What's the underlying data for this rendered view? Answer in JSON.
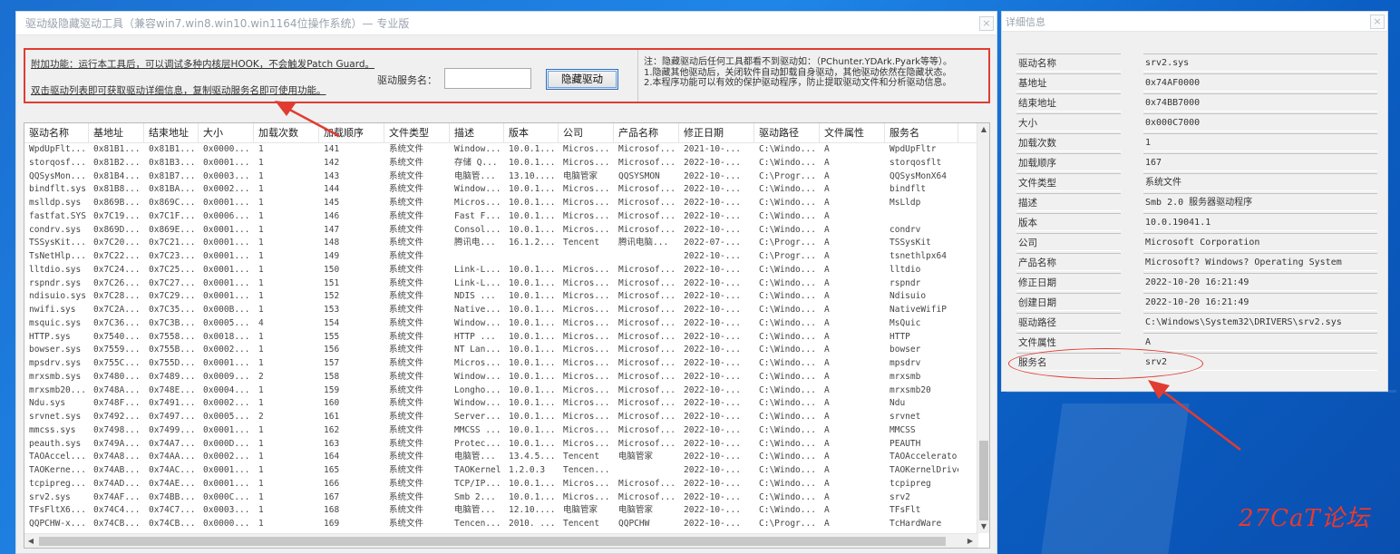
{
  "main_window": {
    "title": "驱动级隐藏驱动工具（兼容win7.win8.win10.win1164位操作系统）— 专业版",
    "close_label": "×"
  },
  "top_panel": {
    "extra_feature_text": "附加功能：运行本工具后，可以调试多种内核层HOOK，不会触发Patch Guard。",
    "double_click_text": "双击驱动列表即可获取驱动详细信息，复制驱动服务名即可使用功能。",
    "service_name_label": "驱动服务名：",
    "service_name_value": "",
    "hide_button_label": "隐藏驱动",
    "notes": [
      "注：隐藏驱动后任何工具都看不到驱动如：（PChunter.YDArk.Pyark等等）。",
      "1.隐藏其他驱动后，关闭软件自动卸载自身驱动，其他驱动依然在隐藏状态。",
      "2.本程序功能可以有效的保护驱动程序，防止提取驱动文件和分析驱动信息。"
    ]
  },
  "driver_table": {
    "columns": [
      "驱动名称",
      "基地址",
      "结束地址",
      "大小",
      "加载次数",
      "加载顺序",
      "文件类型",
      "描述",
      "版本",
      "公司",
      "产品名称",
      "修正日期",
      "驱动路径",
      "文件属性",
      "服务名"
    ],
    "rows": [
      [
        "WpdUpFlt...",
        "0x81B1...",
        "0x81B1...",
        "0x0000...",
        "1",
        "141",
        "系统文件",
        "Window...",
        "10.0.1...",
        "Micros...",
        "Microsof...",
        "2021-10-...",
        "C:\\Windo...",
        "A",
        "WpdUpFltr"
      ],
      [
        "storqosf...",
        "0x81B2...",
        "0x81B3...",
        "0x0001...",
        "1",
        "142",
        "系统文件",
        "存储 Q...",
        "10.0.1...",
        "Micros...",
        "Microsof...",
        "2022-10-...",
        "C:\\Windo...",
        "A",
        "storqosflt"
      ],
      [
        "QQSysMon...",
        "0x81B4...",
        "0x81B7...",
        "0x0003...",
        "1",
        "143",
        "系统文件",
        "电脑管...",
        "13.10....",
        "电脑管家",
        "QQSYSMON",
        "2022-10-...",
        "C:\\Progr...",
        "A",
        "QQSysMonX64"
      ],
      [
        "bindflt.sys",
        "0x81B8...",
        "0x81BA...",
        "0x0002...",
        "1",
        "144",
        "系统文件",
        "Window...",
        "10.0.1...",
        "Micros...",
        "Microsof...",
        "2022-10-...",
        "C:\\Windo...",
        "A",
        "bindflt"
      ],
      [
        "mslldp.sys",
        "0x869B...",
        "0x869C...",
        "0x0001...",
        "1",
        "145",
        "系统文件",
        "Micros...",
        "10.0.1...",
        "Micros...",
        "Microsof...",
        "2022-10-...",
        "C:\\Windo...",
        "A",
        "MsLldp"
      ],
      [
        "fastfat.SYS",
        "0x7C19...",
        "0x7C1F...",
        "0x0006...",
        "1",
        "146",
        "系统文件",
        "Fast F...",
        "10.0.1...",
        "Micros...",
        "Microsof...",
        "2022-10-...",
        "C:\\Windo...",
        "A",
        ""
      ],
      [
        "condrv.sys",
        "0x869D...",
        "0x869E...",
        "0x0001...",
        "1",
        "147",
        "系统文件",
        "Consol...",
        "10.0.1...",
        "Micros...",
        "Microsof...",
        "2022-10-...",
        "C:\\Windo...",
        "A",
        "condrv"
      ],
      [
        "TSSysKit...",
        "0x7C20...",
        "0x7C21...",
        "0x0001...",
        "1",
        "148",
        "系统文件",
        "腾讯电...",
        "16.1.2...",
        "Tencent",
        "腾讯电脑...",
        "2022-07-...",
        "C:\\Progr...",
        "A",
        "TSSysKit"
      ],
      [
        "TsNetHlp...",
        "0x7C22...",
        "0x7C23...",
        "0x0001...",
        "1",
        "149",
        "系统文件",
        "",
        "",
        "",
        "",
        "2022-10-...",
        "C:\\Progr...",
        "A",
        "tsnethlpx64"
      ],
      [
        "lltdio.sys",
        "0x7C24...",
        "0x7C25...",
        "0x0001...",
        "1",
        "150",
        "系统文件",
        "Link-L...",
        "10.0.1...",
        "Micros...",
        "Microsof...",
        "2022-10-...",
        "C:\\Windo...",
        "A",
        "lltdio"
      ],
      [
        "rspndr.sys",
        "0x7C26...",
        "0x7C27...",
        "0x0001...",
        "1",
        "151",
        "系统文件",
        "Link-L...",
        "10.0.1...",
        "Micros...",
        "Microsof...",
        "2022-10-...",
        "C:\\Windo...",
        "A",
        "rspndr"
      ],
      [
        "ndisuio.sys",
        "0x7C28...",
        "0x7C29...",
        "0x0001...",
        "1",
        "152",
        "系统文件",
        "NDIS ...",
        "10.0.1...",
        "Micros...",
        "Microsof...",
        "2022-10-...",
        "C:\\Windo...",
        "A",
        "Ndisuio"
      ],
      [
        "nwifi.sys",
        "0x7C2A...",
        "0x7C35...",
        "0x000B...",
        "1",
        "153",
        "系统文件",
        "Native...",
        "10.0.1...",
        "Micros...",
        "Microsof...",
        "2022-10-...",
        "C:\\Windo...",
        "A",
        "NativeWifiP"
      ],
      [
        "msquic.sys",
        "0x7C36...",
        "0x7C3B...",
        "0x0005...",
        "4",
        "154",
        "系统文件",
        "Window...",
        "10.0.1...",
        "Micros...",
        "Microsof...",
        "2022-10-...",
        "C:\\Windo...",
        "A",
        "MsQuic"
      ],
      [
        "HTTP.sys",
        "0x7540...",
        "0x7558...",
        "0x0018...",
        "1",
        "155",
        "系统文件",
        "HTTP ...",
        "10.0.1...",
        "Micros...",
        "Microsof...",
        "2022-10-...",
        "C:\\Windo...",
        "A",
        "HTTP"
      ],
      [
        "bowser.sys",
        "0x7559...",
        "0x755B...",
        "0x0002...",
        "1",
        "156",
        "系统文件",
        "NT Lan...",
        "10.0.1...",
        "Micros...",
        "Microsof...",
        "2022-10-...",
        "C:\\Windo...",
        "A",
        "bowser"
      ],
      [
        "mpsdrv.sys",
        "0x755C...",
        "0x755D...",
        "0x0001...",
        "1",
        "157",
        "系统文件",
        "Micros...",
        "10.0.1...",
        "Micros...",
        "Microsof...",
        "2022-10-...",
        "C:\\Windo...",
        "A",
        "mpsdrv"
      ],
      [
        "mrxsmb.sys",
        "0x7480...",
        "0x7489...",
        "0x0009...",
        "2",
        "158",
        "系统文件",
        "Window...",
        "10.0.1...",
        "Micros...",
        "Microsof...",
        "2022-10-...",
        "C:\\Windo...",
        "A",
        "mrxsmb"
      ],
      [
        "mrxsmb20...",
        "0x748A...",
        "0x748E...",
        "0x0004...",
        "1",
        "159",
        "系统文件",
        "Longho...",
        "10.0.1...",
        "Micros...",
        "Microsof...",
        "2022-10-...",
        "C:\\Windo...",
        "A",
        "mrxsmb20"
      ],
      [
        "Ndu.sys",
        "0x748F...",
        "0x7491...",
        "0x0002...",
        "1",
        "160",
        "系统文件",
        "Window...",
        "10.0.1...",
        "Micros...",
        "Microsof...",
        "2022-10-...",
        "C:\\Windo...",
        "A",
        "Ndu"
      ],
      [
        "srvnet.sys",
        "0x7492...",
        "0x7497...",
        "0x0005...",
        "2",
        "161",
        "系统文件",
        "Server...",
        "10.0.1...",
        "Micros...",
        "Microsof...",
        "2022-10-...",
        "C:\\Windo...",
        "A",
        "srvnet"
      ],
      [
        "mmcss.sys",
        "0x7498...",
        "0x7499...",
        "0x0001...",
        "1",
        "162",
        "系统文件",
        "MMCSS ...",
        "10.0.1...",
        "Micros...",
        "Microsof...",
        "2022-10-...",
        "C:\\Windo...",
        "A",
        "MMCSS"
      ],
      [
        "peauth.sys",
        "0x749A...",
        "0x74A7...",
        "0x000D...",
        "1",
        "163",
        "系统文件",
        "Protec...",
        "10.0.1...",
        "Micros...",
        "Microsof...",
        "2022-10-...",
        "C:\\Windo...",
        "A",
        "PEAUTH"
      ],
      [
        "TAOAccel...",
        "0x74A8...",
        "0x74AA...",
        "0x0002...",
        "1",
        "164",
        "系统文件",
        "电脑管...",
        "13.4.5...",
        "Tencent",
        "电脑管家",
        "2022-10-...",
        "C:\\Windo...",
        "A",
        "TAOAccelerator"
      ],
      [
        "TAOKerne...",
        "0x74AB...",
        "0x74AC...",
        "0x0001...",
        "1",
        "165",
        "系统文件",
        "TAOKernel",
        "1.2.0.3",
        "Tencen...",
        "",
        "2022-10-...",
        "C:\\Windo...",
        "A",
        "TAOKernelDriver"
      ],
      [
        "tcpipreg...",
        "0x74AD...",
        "0x74AE...",
        "0x0001...",
        "1",
        "166",
        "系统文件",
        "TCP/IP...",
        "10.0.1...",
        "Micros...",
        "Microsof...",
        "2022-10-...",
        "C:\\Windo...",
        "A",
        "tcpipreg"
      ],
      [
        "srv2.sys",
        "0x74AF...",
        "0x74BB...",
        "0x000C...",
        "1",
        "167",
        "系统文件",
        "Smb 2...",
        "10.0.1...",
        "Micros...",
        "Microsof...",
        "2022-10-...",
        "C:\\Windo...",
        "A",
        "srv2"
      ],
      [
        "TFsFltX6...",
        "0x74C4...",
        "0x74C7...",
        "0x0003...",
        "1",
        "168",
        "系统文件",
        "电脑管...",
        "12.10....",
        "电脑管家",
        "电脑管家",
        "2022-10-...",
        "C:\\Windo...",
        "A",
        "TFsFlt"
      ],
      [
        "QQPCHW-x...",
        "0x74CB...",
        "0x74CB...",
        "0x0000...",
        "1",
        "169",
        "系统文件",
        "Tencen...",
        "2010.  ...",
        "Tencent",
        "QQPCHW",
        "2022-10-...",
        "C:\\Progr...",
        "A",
        "TcHardWare"
      ]
    ]
  },
  "detail_window": {
    "title": "详细信息",
    "close_label": "×",
    "fields": [
      {
        "label": "驱动名称",
        "value": "srv2.sys"
      },
      {
        "label": "基地址",
        "value": "0x74AF0000"
      },
      {
        "label": "结束地址",
        "value": "0x74BB7000"
      },
      {
        "label": "大小",
        "value": "0x000C7000"
      },
      {
        "label": "加载次数",
        "value": "1"
      },
      {
        "label": "加载顺序",
        "value": "167"
      },
      {
        "label": "文件类型",
        "value": "系统文件"
      },
      {
        "label": "描述",
        "value": "Smb 2.0 服务器驱动程序"
      },
      {
        "label": "版本",
        "value": "10.0.19041.1"
      },
      {
        "label": "公司",
        "value": "Microsoft Corporation"
      },
      {
        "label": "产品名称",
        "value": "Microsoft? Windows? Operating System"
      },
      {
        "label": "修正日期",
        "value": "2022-10-20 16:21:49"
      },
      {
        "label": "创建日期",
        "value": "2022-10-20 16:21:49"
      },
      {
        "label": "驱动路径",
        "value": "C:\\Windows\\System32\\DRIVERS\\srv2.sys"
      },
      {
        "label": "文件属性",
        "value": "A"
      },
      {
        "label": "服务名",
        "value": "srv2"
      }
    ]
  },
  "watermark": "27CaT论坛",
  "colors": {
    "annotation_red": "#e03c31",
    "desktop_blue": "#1f86e8"
  }
}
